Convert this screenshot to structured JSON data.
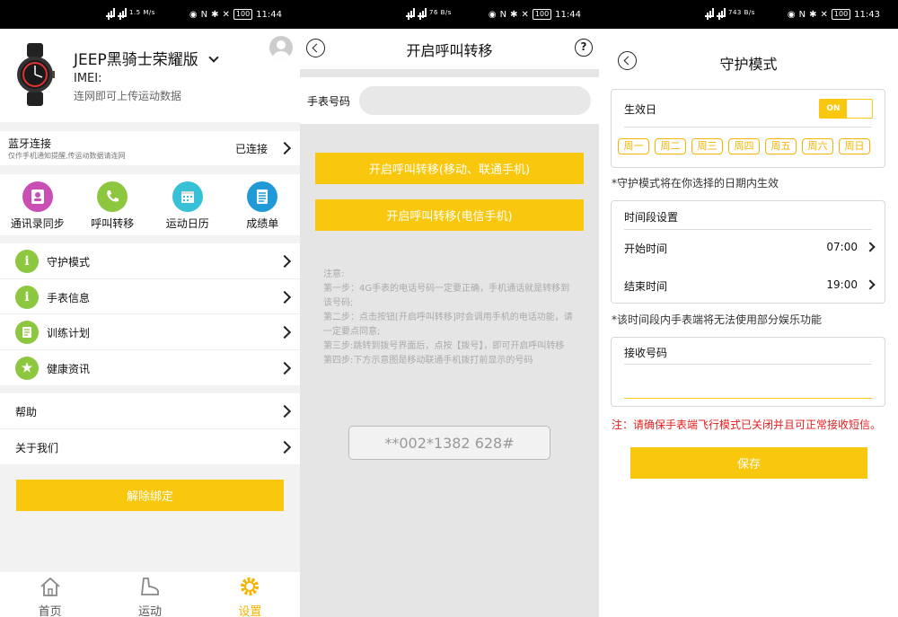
{
  "status_bars": [
    {
      "left": "1.5 M/s",
      "time": "11:44",
      "battery": "100"
    },
    {
      "left": "76 B/s",
      "time": "11:44",
      "battery": "100"
    },
    {
      "left": "743 B/s",
      "time": "11:43",
      "battery": "100"
    }
  ],
  "settings": {
    "device_title": "JEEP黑骑士荣耀版",
    "imei_label": "IMEI:",
    "upload_hint": "连网即可上传运动数据",
    "bluetooth": {
      "title": "蓝牙连接",
      "subtitle": "仅作手机通知提醒,传运动数据请连网",
      "status": "已连接"
    },
    "features": [
      {
        "label": "通讯录同步",
        "color": "#c94fb4",
        "icon": "contacts-icon"
      },
      {
        "label": "呼叫转移",
        "color": "#8dc63f",
        "icon": "call-forward-icon"
      },
      {
        "label": "运动日历",
        "color": "#37c1d6",
        "icon": "calendar-icon"
      },
      {
        "label": "成绩单",
        "color": "#1f9ad6",
        "icon": "report-icon"
      }
    ],
    "menu": [
      {
        "label": "守护模式",
        "icon": "info-icon"
      },
      {
        "label": "手表信息",
        "icon": "info-icon"
      },
      {
        "label": "训练计划",
        "icon": "plan-icon"
      },
      {
        "label": "健康资讯",
        "icon": "star-icon"
      }
    ],
    "menu2": [
      {
        "label": "帮助"
      },
      {
        "label": "关于我们"
      }
    ],
    "unbind_label": "解除绑定",
    "tabs": [
      {
        "label": "首页",
        "icon": "home-icon"
      },
      {
        "label": "运动",
        "icon": "shoe-icon"
      },
      {
        "label": "设置",
        "icon": "gear-icon",
        "active": true
      }
    ]
  },
  "call_forward": {
    "title": "开启呼叫转移",
    "phone_label": "手表号码",
    "phone_value": "",
    "btn_mobile": "开启呼叫转移(移动、联通手机)",
    "btn_telecom": "开启呼叫转移(电信手机)",
    "notes": [
      "注意:",
      "第一步：4G手表的电话号码一定要正确，手机通话就是转移到该号码;",
      "第二步：点击按钮[开启呼叫转移]时会调用手机的电话功能，请一定要点同意;",
      "第三步:跳转到拨号界面后，点按【拨号】，即可开启呼叫转移",
      "第四步:下方示意图是移动联通手机拨打前显示的号码"
    ],
    "dial_example": "**002*1382        628#"
  },
  "guard_mode": {
    "title": "守护模式",
    "effective_label": "生效日",
    "toggle_label": "ON",
    "days": [
      "周一",
      "周二",
      "周三",
      "周四",
      "周五",
      "周六",
      "周日"
    ],
    "days_note": "*守护模式将在你选择的日期内生效",
    "period_title": "时间段设置",
    "start_label": "开始时间",
    "start_value": "07:00",
    "end_label": "结束时间",
    "end_value": "19:00",
    "period_note": "*该时间段内手表端将无法使用部分娱乐功能",
    "receive_label": "接收号码",
    "receive_value": "",
    "warning": "注：请确保手表端飞行模式已关闭并且可正常接收短信。",
    "save_label": "保存",
    "accent_color": "#f9c80e"
  }
}
